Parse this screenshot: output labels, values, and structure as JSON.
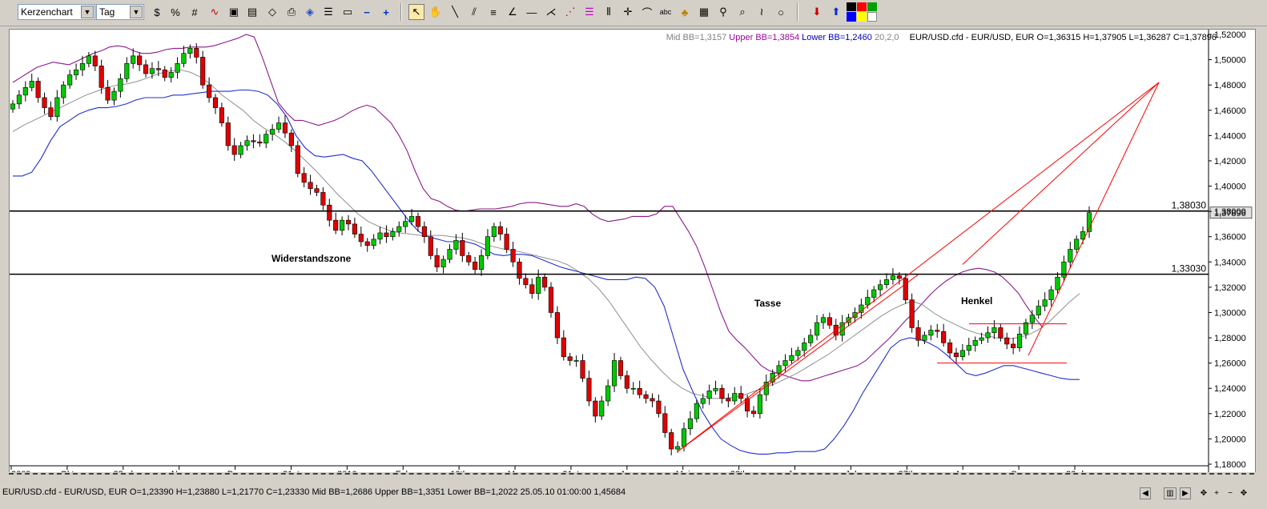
{
  "toolbar": {
    "chart_type": "Kerzenchart",
    "period": "Tag",
    "colors": [
      "#000000",
      "#ff0000",
      "#00a000",
      "#0000ff",
      "#ffff00",
      "#ffffff"
    ]
  },
  "header": {
    "bb_mid": "Mid BB=1,3157",
    "bb_upper": "Upper BB=1,3854",
    "bb_lower": "Lower BB=1,2460",
    "bb_params": "20,2,0",
    "ohlc": "EUR/USD.cfd - EUR/USD, EUR O=1,36315 H=1,37905 L=1,36287 C=1,37896"
  },
  "status": {
    "text": "EUR/USD.cfd - EUR/USD, EUR O=1,23390 H=1,23880 L=1,21770 C=1,23330  Mid BB=1,2686 Upper BB=1,3351 Lower BB=1,2022  25.05.10 01:00:00 1,45684"
  },
  "chart_data": {
    "type": "candlestick",
    "title": "",
    "instrument": "EUR/USD.cfd",
    "ylim": [
      1.18,
      1.52
    ],
    "y_ticks": [
      "1,18000",
      "1,20000",
      "1,22000",
      "1,24000",
      "1,26000",
      "1,28000",
      "1,30000",
      "1,32000",
      "1,34000",
      "1,36000",
      "1,38000",
      "1,40000",
      "1,42000",
      "1,44000",
      "1,46000",
      "1,48000",
      "1,50000",
      "1,52000"
    ],
    "x_labels": [
      "2009",
      "Okt",
      "22nd",
      "Nov",
      "Dez",
      "21st",
      "2010",
      "Feb",
      "19th",
      "Mrz",
      "31st",
      "Apr",
      "Mai",
      "28th",
      "Jun",
      "Jul",
      "27th",
      "Aug",
      "Sep",
      "23rd"
    ],
    "last_price_label": "1,37896",
    "horizontal_lines": [
      {
        "value": 1.3803,
        "label": "1,38030",
        "color": "#000000"
      },
      {
        "value": 1.3303,
        "label": "1,33030",
        "color": "#000000"
      }
    ],
    "annotations": [
      {
        "text": "Widerstandszone"
      },
      {
        "text": "Tasse"
      },
      {
        "text": "Henkel"
      }
    ],
    "close_path": [
      1.465,
      1.472,
      1.478,
      1.483,
      1.47,
      1.462,
      1.455,
      1.47,
      1.48,
      1.488,
      1.492,
      1.497,
      1.503,
      1.495,
      1.478,
      1.468,
      1.475,
      1.485,
      1.497,
      1.503,
      1.496,
      1.489,
      1.493,
      1.492,
      1.486,
      1.49,
      1.497,
      1.505,
      1.509,
      1.502,
      1.48,
      1.47,
      1.462,
      1.45,
      1.432,
      1.425,
      1.432,
      1.436,
      1.435,
      1.434,
      1.441,
      1.445,
      1.45,
      1.442,
      1.432,
      1.41,
      1.403,
      1.398,
      1.395,
      1.385,
      1.373,
      1.365,
      1.373,
      1.37,
      1.362,
      1.356,
      1.353,
      1.358,
      1.363,
      1.36,
      1.364,
      1.368,
      1.372,
      1.376,
      1.368,
      1.36,
      1.345,
      1.336,
      1.342,
      1.35,
      1.357,
      1.345,
      1.34,
      1.334,
      1.345,
      1.36,
      1.368,
      1.362,
      1.35,
      1.34,
      1.327,
      1.322,
      1.315,
      1.328,
      1.32,
      1.3,
      1.28,
      1.265,
      1.262,
      1.262,
      1.248,
      1.23,
      1.218,
      1.23,
      1.242,
      1.262,
      1.25,
      1.24,
      1.24,
      1.235,
      1.232,
      1.23,
      1.22,
      1.205,
      1.192,
      1.194,
      1.208,
      1.216,
      1.228,
      1.232,
      1.238,
      1.24,
      1.232,
      1.23,
      1.236,
      1.232,
      1.222,
      1.22,
      1.235,
      1.245,
      1.252,
      1.258,
      1.262,
      1.266,
      1.27,
      1.276,
      1.282,
      1.292,
      1.296,
      1.29,
      1.282,
      1.292,
      1.296,
      1.3,
      1.306,
      1.312,
      1.318,
      1.322,
      1.326,
      1.329,
      1.327,
      1.31,
      1.288,
      1.278,
      1.282,
      1.286,
      1.285,
      1.276,
      1.268,
      1.265,
      1.27,
      1.274,
      1.278,
      1.28,
      1.284,
      1.288,
      1.28,
      1.275,
      1.272,
      1.283,
      1.292,
      1.298,
      1.305,
      1.31,
      1.318,
      1.328,
      1.34,
      1.35,
      1.358,
      1.364,
      1.379
    ],
    "bb_upper_path": [
      1.482,
      1.486,
      1.49,
      1.494,
      1.496,
      1.498,
      1.497,
      1.496,
      1.499,
      1.502,
      1.505,
      1.507,
      1.51,
      1.511,
      1.51,
      1.507,
      1.505,
      1.505,
      1.506,
      1.508,
      1.509,
      1.509,
      1.51,
      1.51,
      1.51,
      1.511,
      1.513,
      1.515,
      1.517,
      1.52,
      1.518,
      1.502,
      1.484,
      1.466,
      1.458,
      1.452,
      1.452,
      1.45,
      1.448,
      1.45,
      1.452,
      1.455,
      1.459,
      1.462,
      1.464,
      1.462,
      1.456,
      1.45,
      1.44,
      1.428,
      1.412,
      1.398,
      1.39,
      1.388,
      1.384,
      1.381,
      1.38,
      1.381,
      1.382,
      1.382,
      1.382,
      1.383,
      1.384,
      1.386,
      1.387,
      1.387,
      1.386,
      1.385,
      1.384,
      1.384,
      1.386,
      1.384,
      1.378,
      1.374,
      1.372,
      1.373,
      1.374,
      1.376,
      1.376,
      1.376,
      1.378,
      1.384,
      1.384,
      1.374,
      1.364,
      1.352,
      1.336,
      1.318,
      1.3,
      1.285,
      1.278,
      1.272,
      1.265,
      1.258,
      1.254,
      1.252,
      1.25,
      1.248,
      1.246,
      1.246,
      1.248,
      1.25,
      1.252,
      1.254,
      1.256,
      1.258,
      1.262,
      1.268,
      1.274,
      1.28,
      1.287,
      1.294,
      1.3,
      1.307,
      1.314,
      1.32,
      1.325,
      1.329,
      1.332,
      1.334,
      1.335,
      1.334,
      1.332,
      1.328,
      1.322,
      1.315,
      1.305,
      1.296,
      1.288
    ],
    "bb_mid_path": [
      1.443,
      1.448,
      1.452,
      1.456,
      1.46,
      1.464,
      1.468,
      1.472,
      1.475,
      1.478,
      1.48,
      1.481,
      1.483,
      1.486,
      1.489,
      1.491,
      1.492,
      1.49,
      1.486,
      1.48,
      1.472,
      1.466,
      1.46,
      1.452,
      1.446,
      1.441,
      1.435,
      1.428,
      1.42,
      1.412,
      1.403,
      1.394,
      1.386,
      1.378,
      1.372,
      1.368,
      1.365,
      1.363,
      1.362,
      1.361,
      1.361,
      1.361,
      1.36,
      1.359,
      1.357,
      1.354,
      1.352,
      1.35,
      1.349,
      1.347,
      1.345,
      1.343,
      1.341,
      1.338,
      1.333,
      1.327,
      1.319,
      1.309,
      1.297,
      1.285,
      1.273,
      1.263,
      1.254,
      1.246,
      1.24,
      1.236,
      1.234,
      1.232,
      1.232,
      1.233,
      1.235,
      1.238,
      1.241,
      1.244,
      1.248,
      1.252,
      1.257,
      1.262,
      1.267,
      1.273,
      1.279,
      1.285,
      1.291,
      1.297,
      1.302,
      1.306,
      1.309,
      1.306,
      1.3,
      1.295,
      1.291,
      1.287,
      1.284,
      1.282,
      1.28,
      1.279,
      1.28,
      1.282,
      1.286,
      1.292,
      1.3,
      1.308,
      1.315
    ],
    "bb_lower_path": [
      1.408,
      1.408,
      1.411,
      1.422,
      1.436,
      1.447,
      1.452,
      1.457,
      1.46,
      1.462,
      1.462,
      1.463,
      1.465,
      1.468,
      1.47,
      1.47,
      1.47,
      1.472,
      1.472,
      1.473,
      1.474,
      1.475,
      1.475,
      1.475,
      1.476,
      1.476,
      1.475,
      1.472,
      1.465,
      1.455,
      1.44,
      1.43,
      1.424,
      1.423,
      1.424,
      1.425,
      1.422,
      1.42,
      1.412,
      1.402,
      1.392,
      1.382,
      1.372,
      1.364,
      1.36,
      1.358,
      1.356,
      1.356,
      1.356,
      1.354,
      1.35,
      1.346,
      1.345,
      1.346,
      1.346,
      1.345,
      1.342,
      1.339,
      1.336,
      1.334,
      1.332,
      1.33,
      1.328,
      1.326,
      1.326,
      1.326,
      1.328,
      1.327,
      1.32,
      1.305,
      1.28,
      1.255,
      1.238,
      1.222,
      1.21,
      1.2,
      1.195,
      1.191,
      1.189,
      1.188,
      1.188,
      1.189,
      1.189,
      1.19,
      1.19,
      1.19,
      1.192,
      1.2,
      1.21,
      1.222,
      1.236,
      1.248,
      1.26,
      1.272,
      1.278,
      1.28,
      1.279,
      1.276,
      1.272,
      1.266,
      1.259,
      1.252,
      1.25,
      1.252,
      1.255,
      1.258,
      1.258,
      1.256,
      1.254,
      1.252,
      1.25,
      1.248,
      1.247,
      1.247
    ]
  }
}
